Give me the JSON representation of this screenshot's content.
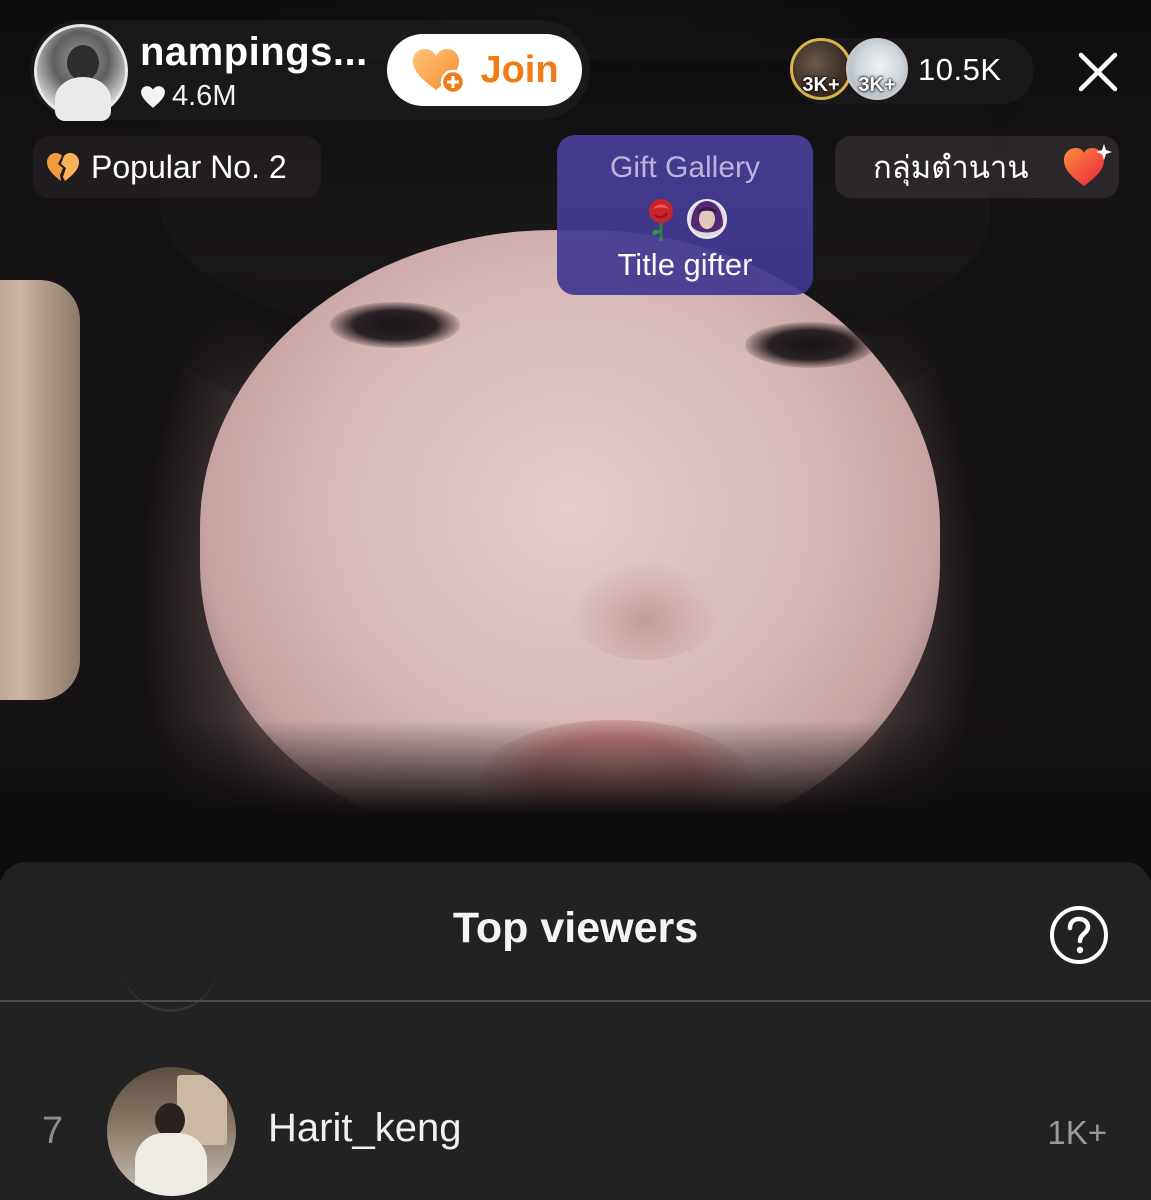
{
  "host": {
    "name": "nampings...",
    "likes": "4.6M",
    "join_label": "Join"
  },
  "top_viewers_preview": {
    "avatar_badges": [
      "3K+",
      "3K+"
    ],
    "viewer_count": "10.5K"
  },
  "badges": {
    "popular": "Popular No. 2",
    "gift_gallery_title": "Gift Gallery",
    "gift_gallery_subtitle": "Title gifter",
    "legend_group": "กลุ่มตำนาน"
  },
  "sheet": {
    "title": "Top viewers",
    "rows": [
      {
        "rank": "7",
        "name": "Harit_keng",
        "score": "1K+"
      }
    ]
  },
  "colors": {
    "join_orange": "#f07a14",
    "gift_gallery_purple": "#4a3f9a",
    "sheet_background": "#222222"
  },
  "icons": {
    "close": "close-icon",
    "help": "help-icon",
    "join": "heart-plus-icon",
    "popular": "broken-heart-icon",
    "legend": "sparkle-heart-icon"
  }
}
